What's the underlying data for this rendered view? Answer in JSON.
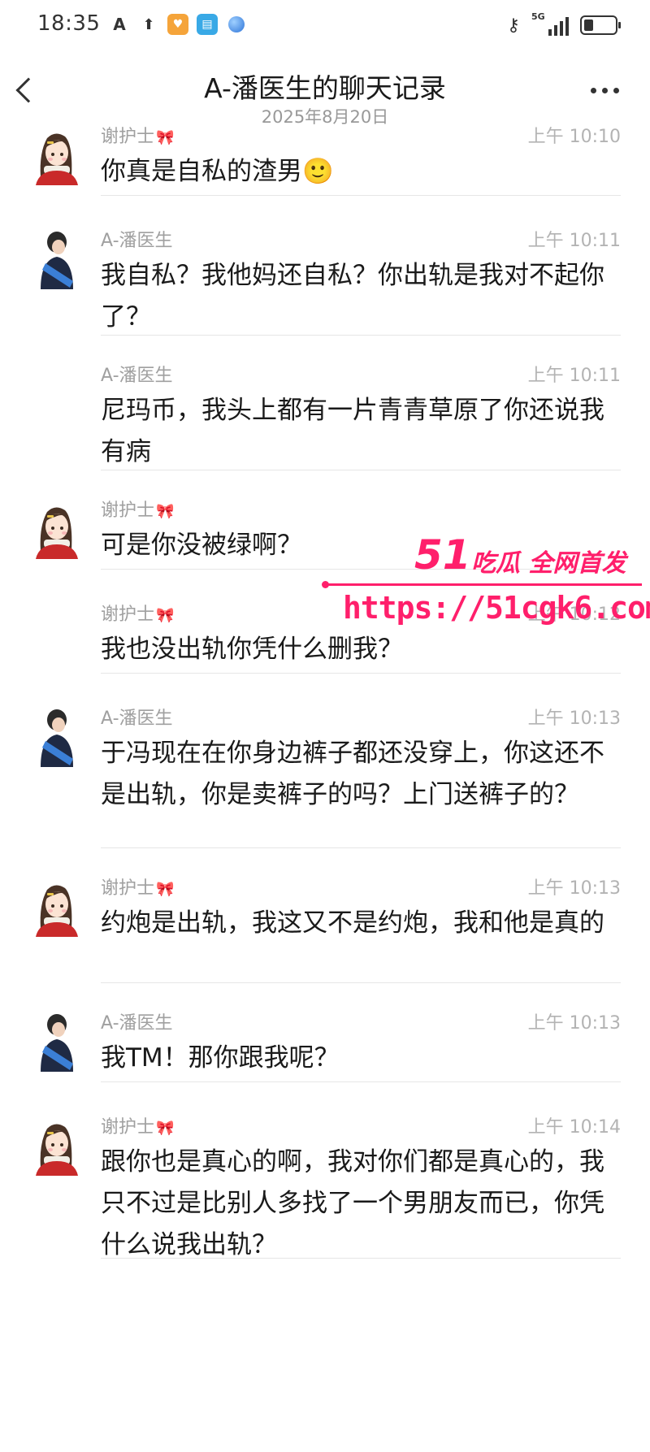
{
  "status": {
    "time": "18:35",
    "network": "5G",
    "battery_level": 0.3
  },
  "header": {
    "title": "A-潘医生的聊天记录",
    "date": "2025年8月20日"
  },
  "icons": {
    "back": "chevron-left-icon",
    "more": "more-icon",
    "bow": "bow-emoji"
  },
  "messages": [
    {
      "sender": "谢护士",
      "time": "上午 10:10",
      "text": "你真是自私的渣男🙂",
      "avatar": "female"
    },
    {
      "sender": "A-潘医生",
      "time": "上午 10:11",
      "text": "我自私？我他妈还自私？你出轨是我对不起你了？",
      "avatar": "male"
    },
    {
      "sender": "A-潘医生",
      "time": "上午 10:11",
      "text": "尼玛币，我头上都有一片青青草原了你还说我有病",
      "avatar": ""
    },
    {
      "sender": "谢护士",
      "time": "",
      "text": "可是你没被绿啊？",
      "avatar": "female"
    },
    {
      "sender": "谢护士",
      "time": "上午 10:12",
      "text": "我也没出轨你凭什么删我？",
      "avatar": ""
    },
    {
      "sender": "A-潘医生",
      "time": "上午 10:13",
      "text": "于冯现在在你身边裤子都还没穿上，你这还不是出轨，你是卖裤子的吗？上门送裤子的？",
      "avatar": "male"
    },
    {
      "sender": "谢护士",
      "time": "上午 10:13",
      "text": "约炮是出轨，我这又不是约炮，我和他是真的",
      "avatar": "female"
    },
    {
      "sender": "A-潘医生",
      "time": "上午 10:13",
      "text": "我TM！那你跟我呢？",
      "avatar": "male"
    },
    {
      "sender": "谢护士",
      "time": "上午 10:14",
      "text": "跟你也是真心的啊，我对你们都是真心的，我只不过是比别人多找了一个男朋友而已，你凭什么说我出轨？",
      "avatar": "female"
    }
  ],
  "watermark": {
    "brand": "51",
    "tagline": "吃瓜 全网首发",
    "url": "https://51cgk6.com"
  }
}
